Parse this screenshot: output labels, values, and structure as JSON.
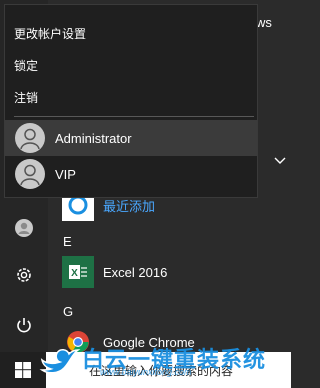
{
  "account_menu": {
    "change_settings": "更改帐户设置",
    "lock": "锁定",
    "sign_out": "注销",
    "users": [
      {
        "name": "Administrator",
        "selected": true
      },
      {
        "name": "VIP",
        "selected": false
      }
    ]
  },
  "app_list": {
    "behind_text": "ws",
    "recent_label": "最近添加",
    "sections": [
      {
        "letter": "E",
        "apps": [
          "Excel 2016"
        ]
      },
      {
        "letter": "G",
        "apps": [
          "Google Chrome"
        ]
      }
    ]
  },
  "taskbar": {
    "search_placeholder": "在这里输入你要搜索的内容"
  },
  "watermark": {
    "text": "白云一键重装系统",
    "url": "www.baiyunxitong.com"
  },
  "colors": {
    "accent": "#1a8fe0",
    "recent_label": "#4aa8ff",
    "excel_green": "#1e7145"
  }
}
